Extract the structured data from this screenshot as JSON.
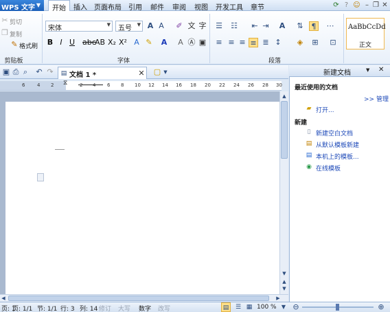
{
  "app": {
    "title": "WPS 文字"
  },
  "menu_tabs": [
    "开始",
    "插入",
    "页面布局",
    "引用",
    "邮件",
    "审阅",
    "视图",
    "开发工具",
    "章节"
  ],
  "clipboard": {
    "cut": "剪切",
    "copy": "复制",
    "format_painter": "格式刷",
    "group_label": "剪贴板"
  },
  "font": {
    "name": "宋体",
    "size": "五号",
    "group_label": "字体"
  },
  "paragraph": {
    "group_label": "段落"
  },
  "styles": {
    "preview": "AaBbCcDd",
    "name": "正文"
  },
  "document": {
    "tab_title": "文档 1 *"
  },
  "ruler": {
    "numbers": [
      "6",
      "4",
      "2",
      "2",
      "4",
      "6",
      "8",
      "10",
      "12",
      "14",
      "16",
      "18",
      "20",
      "22",
      "24",
      "26",
      "28",
      "30"
    ]
  },
  "task_pane": {
    "title": "新建文档",
    "recent_heading": "最近使用的文档",
    "manage_link": ">> 管理",
    "open_link": "打开...",
    "new_heading": "新建",
    "new_items": [
      "新建空白文档",
      "从默认模板新建",
      "本机上的模板...",
      "在线模板"
    ]
  },
  "status": {
    "page": "页: 1",
    "pages": "页: 1/1",
    "section": "节: 1/1",
    "row": "行: 3",
    "col": "列: 14",
    "revision": "修订",
    "caps": "大写",
    "numlock": "数字",
    "overwrite": "改写",
    "zoom": "100 %"
  },
  "colors": {
    "accent": "#1b5fb8",
    "link": "#1d49b8",
    "highlight": "#f0b850"
  }
}
